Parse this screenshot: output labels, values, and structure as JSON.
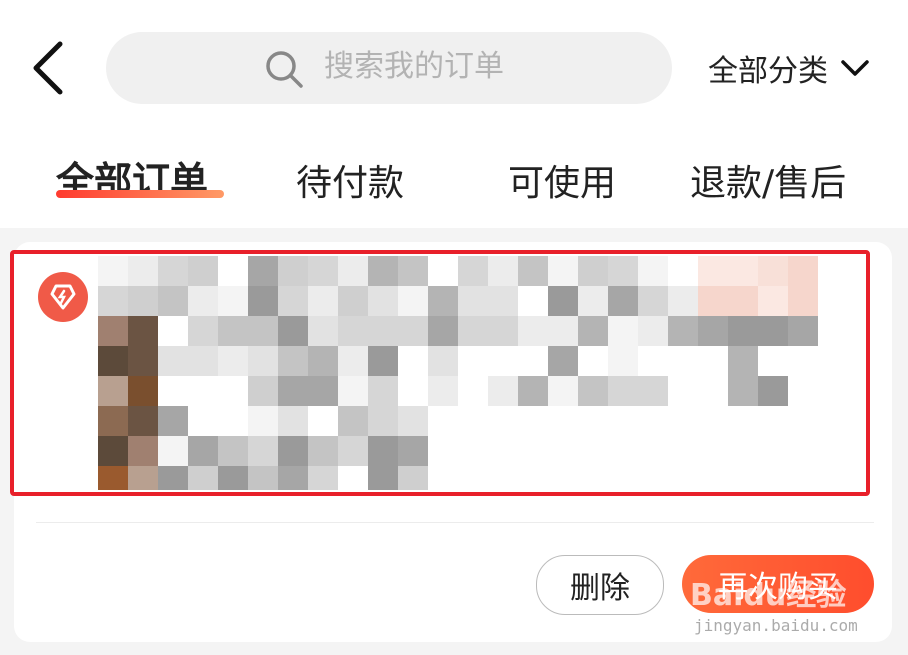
{
  "header": {
    "back_icon": "chevron-left-icon",
    "search_placeholder": "搜索我的订单",
    "search_icon": "search-icon",
    "category_label": "全部分类",
    "category_icon": "chevron-down-icon"
  },
  "tabs": [
    {
      "label": "全部订单",
      "active": true
    },
    {
      "label": "待付款",
      "active": false
    },
    {
      "label": "可使用",
      "active": false
    },
    {
      "label": "退款/售后",
      "active": false
    }
  ],
  "order": {
    "shop_icon": "shop-badge-icon",
    "shop_name_visible": "/",
    "content_note": "pixelated",
    "highlight_color": "#e8202a"
  },
  "actions": {
    "delete_label": "删除",
    "rebuy_label": "再次购买"
  },
  "watermark": {
    "logo": "Baidu经验",
    "url": "jingyan.baidu.com"
  },
  "colors": {
    "accent": "#ff4d2d",
    "background": "#f4f4f4"
  }
}
